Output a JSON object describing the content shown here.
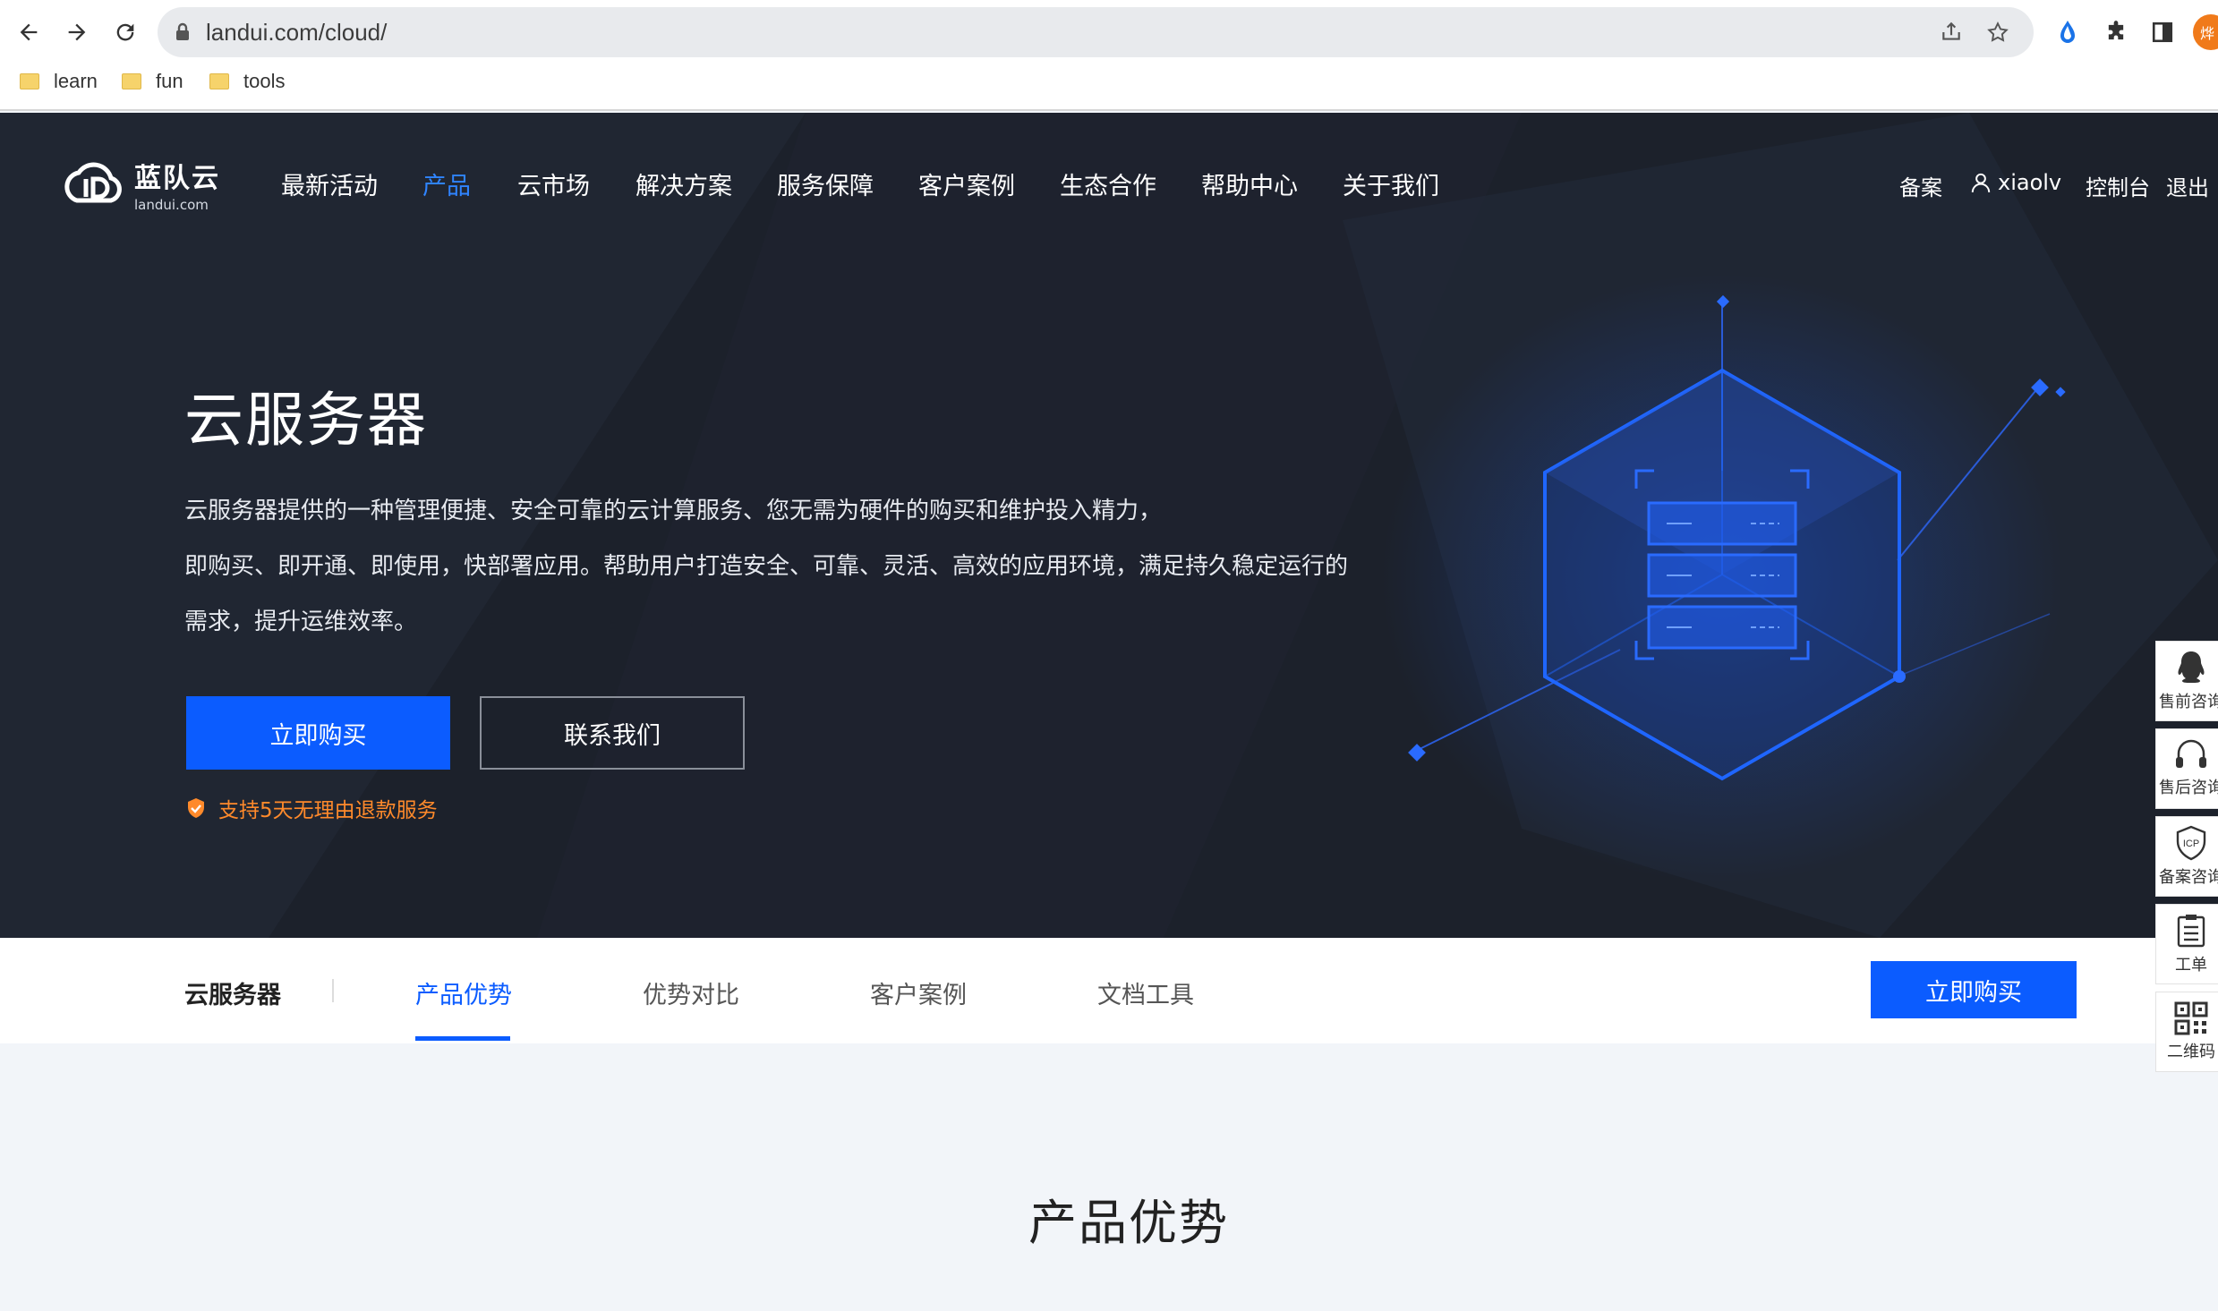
{
  "browser": {
    "url": "landui.com/cloud/",
    "bookmarks": [
      {
        "label": "learn"
      },
      {
        "label": "fun"
      },
      {
        "label": "tools"
      }
    ],
    "profile_badge": "烨"
  },
  "header": {
    "logo_main": "蓝队云",
    "logo_sub": "landui.com",
    "menu": [
      {
        "label": "最新活动",
        "active": false
      },
      {
        "label": "产品",
        "active": true
      },
      {
        "label": "云市场",
        "active": false
      },
      {
        "label": "解决方案",
        "active": false
      },
      {
        "label": "服务保障",
        "active": false
      },
      {
        "label": "客户案例",
        "active": false
      },
      {
        "label": "生态合作",
        "active": false
      },
      {
        "label": "帮助中心",
        "active": false
      },
      {
        "label": "关于我们",
        "active": false
      }
    ],
    "right": {
      "beian": "备案",
      "username": "xiaolv",
      "console": "控制台",
      "logout": "退出"
    }
  },
  "hero": {
    "title": "云服务器",
    "desc_lines": [
      "云服务器提供的一种管理便捷、安全可靠的云计算服务、您无需为硬件的购买和维护投入精力，",
      "即购买、即开通、即使用，快部署应用。帮助用户打造安全、可靠、灵活、高效的应用环境，满足持久稳定运行的",
      "需求，提升运维效率。"
    ],
    "buy_label": "立即购买",
    "contact_label": "联系我们",
    "refund_text": "支持5天无理由退款服务"
  },
  "subnav": {
    "title": "云服务器",
    "tabs": [
      {
        "label": "产品优势",
        "active": true
      },
      {
        "label": "优势对比",
        "active": false
      },
      {
        "label": "客户案例",
        "active": false
      },
      {
        "label": "文档工具",
        "active": false
      }
    ],
    "buy_label": "立即购买"
  },
  "section": {
    "title": "产品优势"
  },
  "float_bar": [
    {
      "label": "售前咨询",
      "icon": "qq-icon"
    },
    {
      "label": "售后咨询",
      "icon": "headset-icon"
    },
    {
      "label": "备案咨询",
      "icon": "icp-shield-icon"
    },
    {
      "label": "工单",
      "icon": "clipboard-icon"
    },
    {
      "label": "二维码",
      "icon": "qrcode-icon"
    }
  ],
  "colors": {
    "brand_blue": "#0b5cff",
    "hero_bg": "#1c212b",
    "refund_orange": "#ff8a2b"
  }
}
